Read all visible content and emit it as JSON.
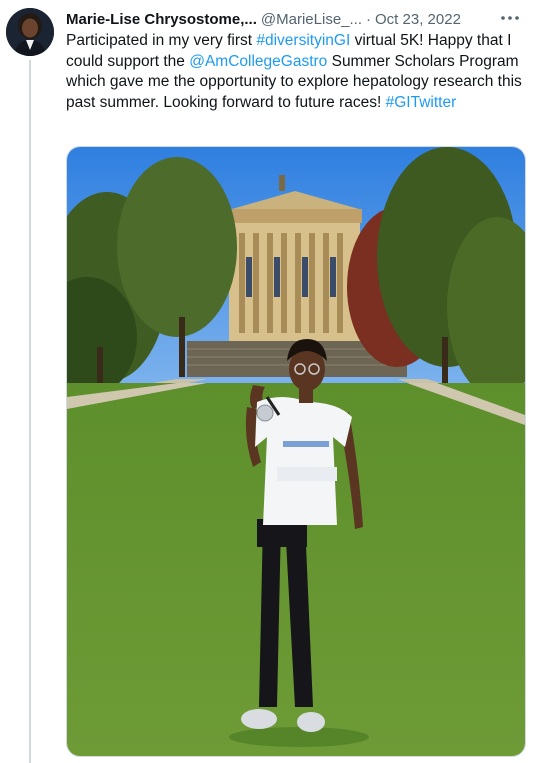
{
  "author": {
    "display_name": "Marie-Lise Chrysostome,...",
    "handle": "@MarieLise_...",
    "separator": "·",
    "date": "Oct 23, 2022"
  },
  "more_label": "•••",
  "text_parts": {
    "p1": "Participated in my very first ",
    "hashtag1": "#diversityinGI",
    "p2": " virtual 5K! Happy that I could support the ",
    "mention": "@AmCollegeGastro",
    "p3": " Summer Scholars Program which gave me the opportunity to explore hepatology research this past summer. Looking forward to future races! ",
    "hashtag2": "#GITwitter"
  },
  "colors": {
    "link": "#1d9bf0",
    "text": "#0f1419",
    "muted": "#536471"
  },
  "media": {
    "icons": [
      "photo-of-woman-with-medal-in-front-of-museum"
    ]
  }
}
